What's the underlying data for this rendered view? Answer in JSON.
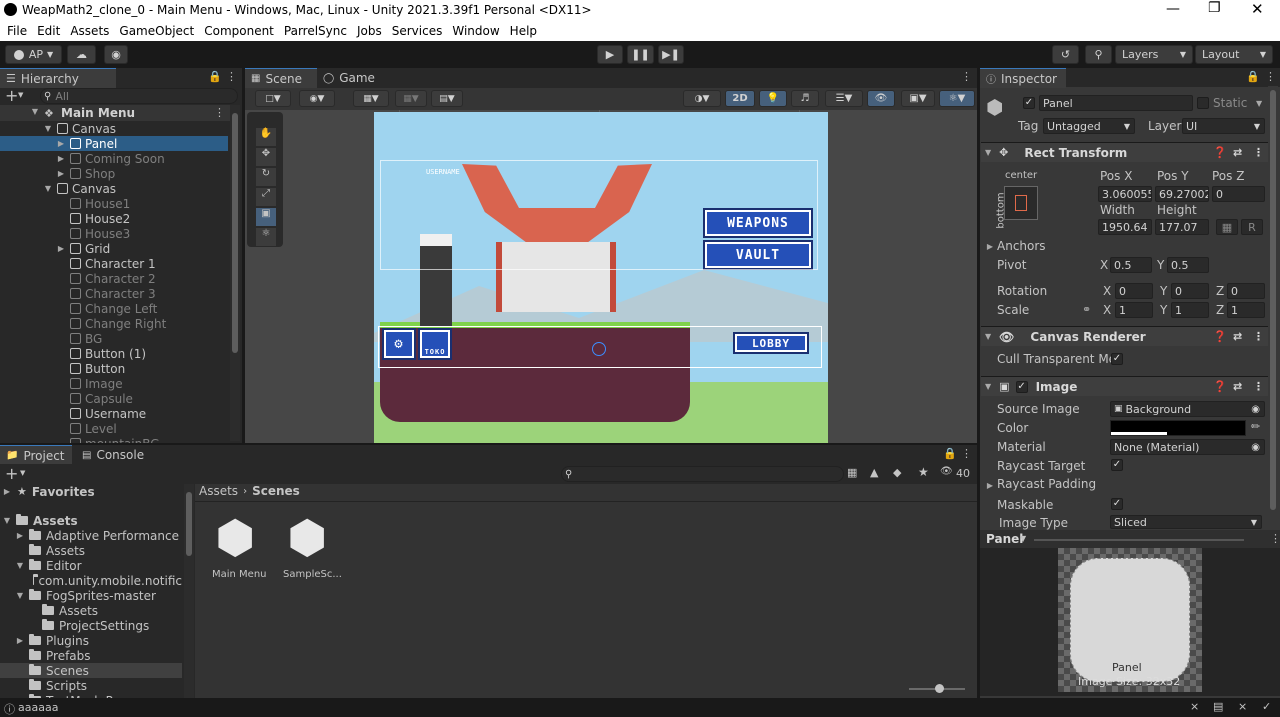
{
  "window": {
    "title": "WeapMath2_clone_0 - Main Menu - Windows, Mac, Linux - Unity 2021.3.39f1 Personal <DX11>"
  },
  "menu": [
    "File",
    "Edit",
    "Assets",
    "GameObject",
    "Component",
    "ParrelSync",
    "Jobs",
    "Services",
    "Window",
    "Help"
  ],
  "toolbar": {
    "account": "AP",
    "layers": "Layers",
    "layout": "Layout"
  },
  "hierarchy": {
    "tab": "Hierarchy",
    "search_placeholder": "All",
    "scene": "Main Menu",
    "items": [
      {
        "label": "Canvas",
        "dim": false
      },
      {
        "label": "Panel",
        "dim": false
      },
      {
        "label": "Coming Soon",
        "dim": true
      },
      {
        "label": "Shop",
        "dim": true
      },
      {
        "label": "Canvas",
        "dim": false
      },
      {
        "label": "House1",
        "dim": true
      },
      {
        "label": "House2",
        "dim": false
      },
      {
        "label": "House3",
        "dim": true
      },
      {
        "label": "Grid",
        "dim": false
      },
      {
        "label": "Character 1",
        "dim": false
      },
      {
        "label": "Character 2",
        "dim": true
      },
      {
        "label": "Character 3",
        "dim": true
      },
      {
        "label": "Change Left",
        "dim": true
      },
      {
        "label": "Change Right",
        "dim": true
      },
      {
        "label": "BG",
        "dim": true
      },
      {
        "label": "Button (1)",
        "dim": false
      },
      {
        "label": "Button",
        "dim": false
      },
      {
        "label": "Image",
        "dim": true
      },
      {
        "label": "Capsule",
        "dim": true
      },
      {
        "label": "Username",
        "dim": false
      },
      {
        "label": "Level",
        "dim": true
      },
      {
        "label": "mountainBG",
        "dim": true
      }
    ]
  },
  "scene_view": {
    "tab_scene": "Scene",
    "tab_game": "Game",
    "mode_2d": "2D",
    "game": {
      "weapons": "WEAPONS",
      "vault": "VAULT",
      "lobby": "LOBBY",
      "username": "USERNAME",
      "toko": "TOKO"
    }
  },
  "inspector": {
    "tab": "Inspector",
    "object_name": "Panel",
    "static_label": "Static",
    "tag_label": "Tag",
    "tag_value": "Untagged",
    "layer_label": "Layer",
    "layer_value": "UI",
    "rect_transform": {
      "title": "Rect Transform",
      "anchor_h": "center",
      "anchor_v": "bottom",
      "posx_label": "Pos X",
      "posy_label": "Pos Y",
      "posz_label": "Pos Z",
      "posx": "3.060055",
      "posy": "69.27002",
      "posz": "0",
      "width_label": "Width",
      "height_label": "Height",
      "width": "1950.64",
      "height": "177.07",
      "r_btn": "R",
      "anchors_label": "Anchors",
      "pivot_label": "Pivot",
      "pivot_x": "0.5",
      "pivot_y": "0.5",
      "rotation_label": "Rotation",
      "rot_x": "0",
      "rot_y": "0",
      "rot_z": "0",
      "scale_label": "Scale",
      "scale_x": "1",
      "scale_y": "1",
      "scale_z": "1",
      "x": "X",
      "y": "Y",
      "z": "Z"
    },
    "canvas_renderer": {
      "title": "Canvas Renderer",
      "cull_label": "Cull Transparent Mes"
    },
    "image": {
      "title": "Image",
      "source_label": "Source Image",
      "source_value": "Background",
      "color_label": "Color",
      "material_label": "Material",
      "material_value": "None (Material)",
      "raycast_target_label": "Raycast Target",
      "raycast_padding_label": "Raycast Padding",
      "maskable_label": "Maskable",
      "image_type_label": "Image Type",
      "image_type_value": "Sliced"
    },
    "preview": {
      "name": "Panel",
      "caption": "Panel",
      "size": "Image Size: 32x32"
    }
  },
  "project": {
    "tab_project": "Project",
    "tab_console": "Console",
    "count": "40",
    "favorites": "Favorites",
    "breadcrumb_root": "Assets",
    "breadcrumb_leaf": "Scenes",
    "tree": [
      {
        "label": "Assets",
        "indent": 0,
        "bold": true
      },
      {
        "label": "Adaptive Performance",
        "indent": 1
      },
      {
        "label": "Assets",
        "indent": 1
      },
      {
        "label": "Editor",
        "indent": 1
      },
      {
        "label": "com.unity.mobile.notific",
        "indent": 2
      },
      {
        "label": "FogSprites-master",
        "indent": 1
      },
      {
        "label": "Assets",
        "indent": 2
      },
      {
        "label": "ProjectSettings",
        "indent": 2
      },
      {
        "label": "Plugins",
        "indent": 1
      },
      {
        "label": "Prefabs",
        "indent": 1
      },
      {
        "label": "Scenes",
        "indent": 1,
        "sel": true
      },
      {
        "label": "Scripts",
        "indent": 1
      },
      {
        "label": "TextMesh Pro",
        "indent": 1
      }
    ],
    "files": [
      "Main Menu",
      "SampleSc..."
    ]
  },
  "status": {
    "text": "aaaaaa"
  }
}
